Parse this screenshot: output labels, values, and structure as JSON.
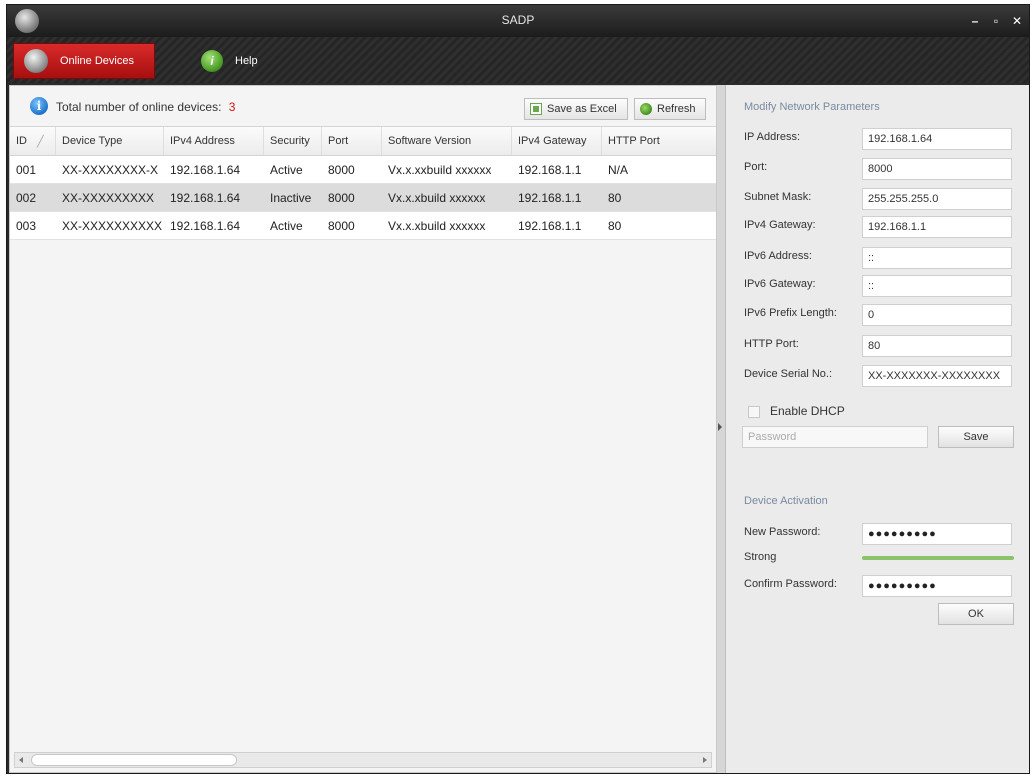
{
  "window": {
    "title": "SADP",
    "controls": [
      "–",
      "▫",
      "✕"
    ]
  },
  "tabs": [
    {
      "label": "Online Devices",
      "icon": "devices-icon",
      "active": true
    },
    {
      "label": "Help",
      "icon": "help-icon",
      "active": false
    }
  ],
  "toolbar": {
    "total_label": "Total number of online devices:",
    "total_count": "3",
    "save_excel_label": "Save as Excel",
    "refresh_label": "Refresh"
  },
  "table": {
    "headers": [
      "ID",
      "Device Type",
      "IPv4 Address",
      "Security",
      "Port",
      "Software Version",
      "IPv4 Gateway",
      "HTTP Port"
    ],
    "rows": [
      [
        "001",
        "XX-XXXXXXXX-X",
        "192.168.1.64",
        "Active",
        "8000",
        "Vx.x.xxbuild xxxxxx",
        "192.168.1.1",
        "N/A"
      ],
      [
        "002",
        "XX-XXXXXXXXX",
        "192.168.1.64",
        "Inactive",
        "8000",
        "Vx.x.xbuild xxxxxx",
        "192.168.1.1",
        "80"
      ],
      [
        "003",
        "XX-XXXXXXXXXX",
        "192.168.1.64",
        "Active",
        "8000",
        "Vx.x.xbuild xxxxxx",
        "192.168.1.1",
        "80"
      ]
    ],
    "selected_row": 1
  },
  "modify": {
    "title": "Modify Network Parameters",
    "fields": [
      {
        "label": "IP Address:",
        "value": "192.168.1.64"
      },
      {
        "label": "Port:",
        "value": "8000"
      },
      {
        "label": "Subnet Mask:",
        "value": "255.255.255.0"
      },
      {
        "label": "IPv4 Gateway:",
        "value": "192.168.1.1"
      },
      {
        "label": "IPv6 Address:",
        "value": "::"
      },
      {
        "label": "IPv6 Gateway:",
        "value": "::"
      },
      {
        "label": "IPv6 Prefix Length:",
        "value": "0"
      },
      {
        "label": "HTTP Port:",
        "value": "80"
      },
      {
        "label": "Device Serial No.:",
        "value": "XX-XXXXXXX-XXXXXXXX"
      }
    ],
    "dhcp_label": "Enable DHCP",
    "password_placeholder": "Password",
    "save_label": "Save"
  },
  "activation": {
    "title": "Device Activation",
    "new_password_label": "New Password:",
    "new_password_value": "●●●●●●●●●",
    "strength_label": "Strong",
    "strength_color": "#8cc36a",
    "confirm_password_label": "Confirm Password:",
    "confirm_password_value": "●●●●●●●●●",
    "ok_label": "OK"
  }
}
